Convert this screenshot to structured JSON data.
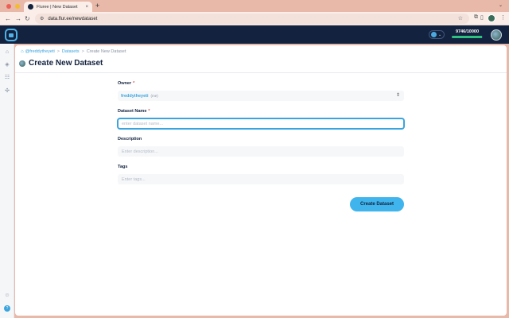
{
  "browser": {
    "tab_title": "Fluree | New Dataset",
    "tab_close": "×",
    "new_tab": "+",
    "tabstrip_chevron": "⌄",
    "url": "data.flur.ee/newdataset",
    "back_icon": "←",
    "forward_icon": "→",
    "reload_icon": "↻",
    "site_icon": "⚙",
    "star_icon": "☆",
    "extensions_icon": "⧉",
    "sidepanel_icon": "▯",
    "menu_icon": "⋮"
  },
  "header": {
    "network_chevron": "⌄",
    "quota_text": "9746/10000",
    "quota_fraction": 0.9746
  },
  "rail": {
    "icons": [
      {
        "name": "home-icon",
        "glyph": "⌂"
      },
      {
        "name": "layers-icon",
        "glyph": "◈"
      },
      {
        "name": "datasets-icon",
        "glyph": "☷"
      },
      {
        "name": "network-icon",
        "glyph": "✣"
      },
      {
        "name": "team-icon",
        "glyph": "☺"
      }
    ],
    "help_glyph": "?"
  },
  "breadcrumb": {
    "home_glyph": "⌂",
    "user": "@freddytheyeti",
    "section": "Datasets",
    "current": "Create New Dataset",
    "sep": ">"
  },
  "page": {
    "title": "Create New Dataset"
  },
  "form": {
    "owner_label": "Owner",
    "owner_value": "freddytheyeti",
    "owner_suffix": "(me)",
    "owner_chevron": "⌃⌄",
    "required_mark": "*",
    "name_label": "Dataset Name",
    "name_placeholder": "enter dataset name...",
    "description_label": "Description",
    "description_placeholder": "Enter description...",
    "tags_label": "Tags",
    "tags_placeholder": "Enter tags...",
    "submit_label": "Create Dataset"
  },
  "colors": {
    "header_bg": "#13223f",
    "accent": "#40b4ec",
    "required": "#e0454a",
    "quota_fill": "#2fc07f"
  }
}
